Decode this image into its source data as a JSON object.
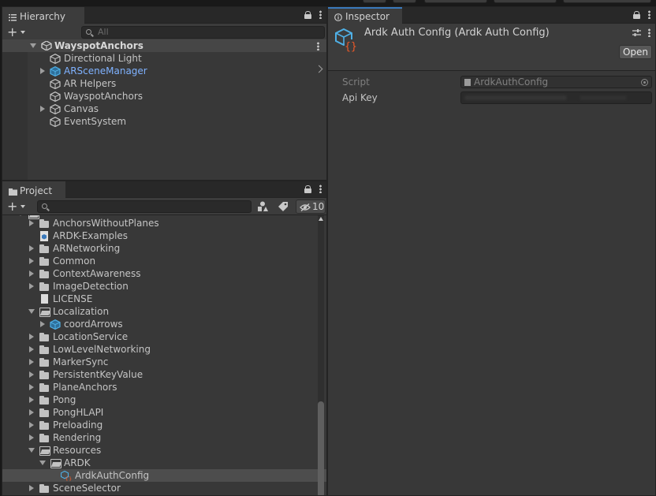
{
  "hierarchy": {
    "tab_title": "Hierarchy",
    "search_placeholder": "All",
    "scene_name": "WayspotAnchors",
    "items": [
      {
        "label": "Directional Light",
        "depth": 1,
        "fold": "none",
        "icon": "gameobject-cube-icon",
        "color": "#c4c4c4"
      },
      {
        "label": "ARSceneManager",
        "depth": 1,
        "fold": "right",
        "icon": "prefab-cube-icon",
        "color": "#7fb2ff"
      },
      {
        "label": "AR Helpers",
        "depth": 1,
        "fold": "none",
        "icon": "gameobject-cube-icon",
        "color": "#c4c4c4"
      },
      {
        "label": "WayspotAnchors",
        "depth": 1,
        "fold": "none",
        "icon": "gameobject-cube-icon",
        "color": "#c4c4c4"
      },
      {
        "label": "Canvas",
        "depth": 1,
        "fold": "right",
        "icon": "gameobject-cube-icon",
        "color": "#c4c4c4"
      },
      {
        "label": "EventSystem",
        "depth": 1,
        "fold": "none",
        "icon": "gameobject-cube-icon",
        "color": "#c4c4c4"
      }
    ]
  },
  "project": {
    "tab_title": "Project",
    "hidden_count": "10",
    "items": [
      {
        "label": "AnchorsWithoutPlanes",
        "depth": 1,
        "fold": "right",
        "icon": "folder-icon"
      },
      {
        "label": "ARDK-Examples",
        "depth": 1,
        "fold": "none",
        "icon": "asmdef-icon"
      },
      {
        "label": "ARNetworking",
        "depth": 1,
        "fold": "right",
        "icon": "folder-icon"
      },
      {
        "label": "Common",
        "depth": 1,
        "fold": "right",
        "icon": "folder-icon"
      },
      {
        "label": "ContextAwareness",
        "depth": 1,
        "fold": "right",
        "icon": "folder-icon"
      },
      {
        "label": "ImageDetection",
        "depth": 1,
        "fold": "right",
        "icon": "folder-icon"
      },
      {
        "label": "LICENSE",
        "depth": 1,
        "fold": "none",
        "icon": "file-icon"
      },
      {
        "label": "Localization",
        "depth": 1,
        "fold": "down",
        "icon": "folder-open-icon"
      },
      {
        "label": "coordArrows",
        "depth": 2,
        "fold": "right",
        "icon": "prefab-cube-icon"
      },
      {
        "label": "LocationService",
        "depth": 1,
        "fold": "right",
        "icon": "folder-icon"
      },
      {
        "label": "LowLevelNetworking",
        "depth": 1,
        "fold": "right",
        "icon": "folder-icon"
      },
      {
        "label": "MarkerSync",
        "depth": 1,
        "fold": "right",
        "icon": "folder-icon"
      },
      {
        "label": "PersistentKeyValue",
        "depth": 1,
        "fold": "right",
        "icon": "folder-icon"
      },
      {
        "label": "PlaneAnchors",
        "depth": 1,
        "fold": "right",
        "icon": "folder-icon"
      },
      {
        "label": "Pong",
        "depth": 1,
        "fold": "right",
        "icon": "folder-icon"
      },
      {
        "label": "PongHLAPI",
        "depth": 1,
        "fold": "right",
        "icon": "folder-icon"
      },
      {
        "label": "Preloading",
        "depth": 1,
        "fold": "right",
        "icon": "folder-icon"
      },
      {
        "label": "Rendering",
        "depth": 1,
        "fold": "right",
        "icon": "folder-icon"
      },
      {
        "label": "Resources",
        "depth": 1,
        "fold": "down",
        "icon": "folder-open-icon"
      },
      {
        "label": "ARDK",
        "depth": 2,
        "fold": "down",
        "icon": "folder-open-icon"
      },
      {
        "label": "ArdkAuthConfig",
        "depth": 3,
        "fold": "none",
        "icon": "scriptable-object-icon",
        "selected": true
      },
      {
        "label": "SceneSelector",
        "depth": 1,
        "fold": "right",
        "icon": "folder-icon"
      }
    ]
  },
  "inspector": {
    "tab_title": "Inspector",
    "object_title": "Ardk Auth Config (Ardk Auth Config)",
    "open_label": "Open",
    "script_label": "Script",
    "script_value": "ArdkAuthConfig",
    "api_key_label": "Api Key",
    "api_key_value": ""
  },
  "colors": {
    "accent": "#3a79bb",
    "prefab_blue": "#7fb2ff",
    "panel_bg": "#383838"
  }
}
